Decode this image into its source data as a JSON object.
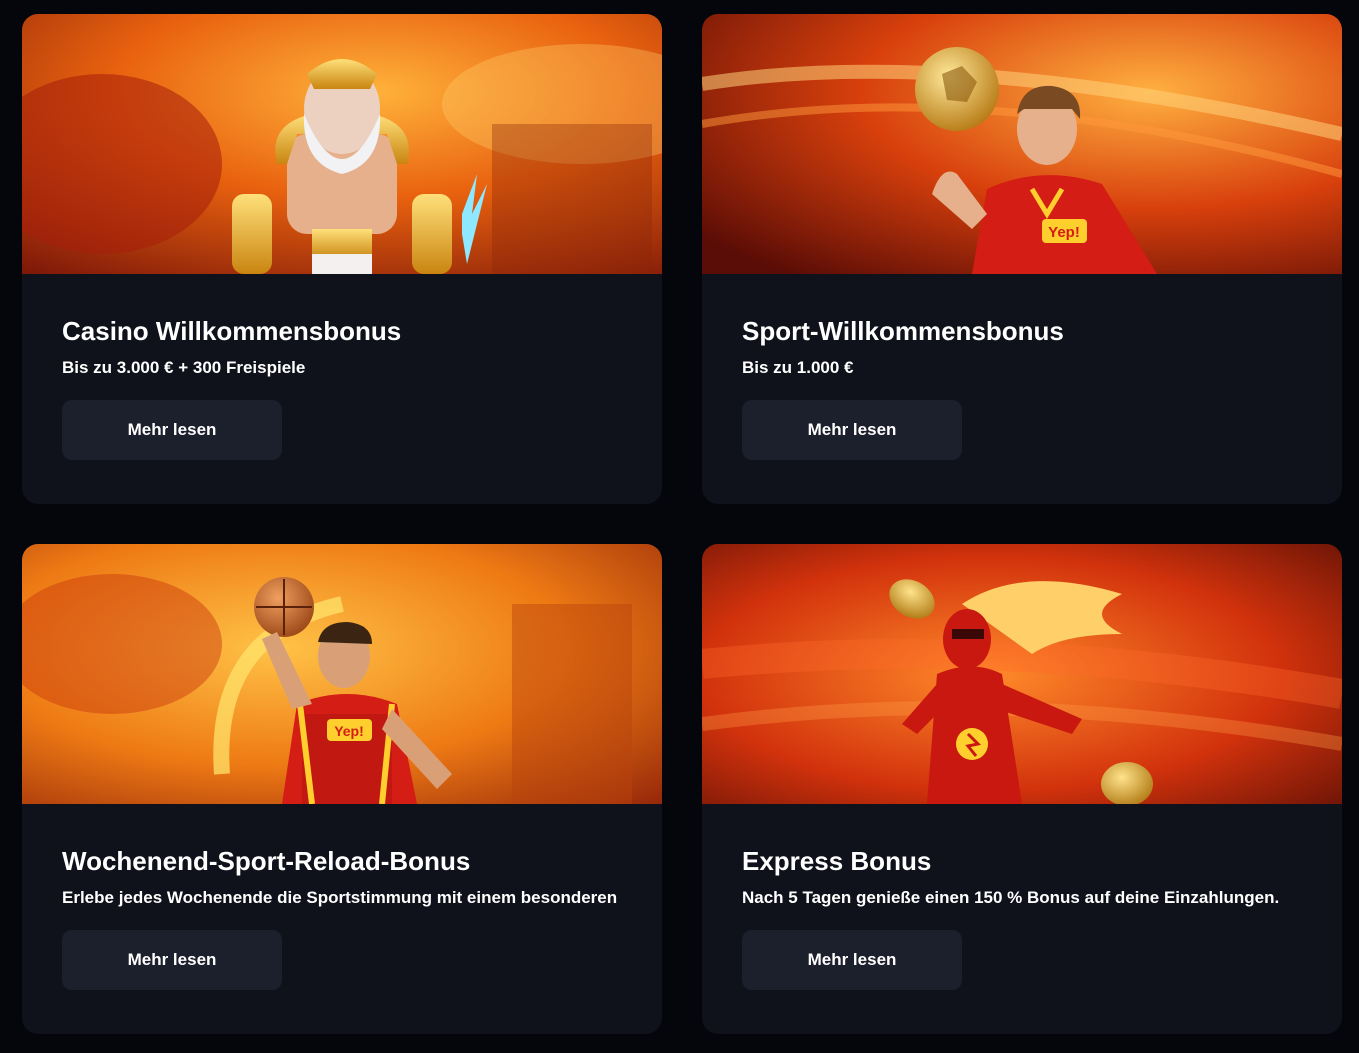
{
  "cards": [
    {
      "title": "Casino Willkommensbonus",
      "subtitle": "Bis zu 3.000 € + 300 Freispiele",
      "button_label": "Mehr lesen",
      "image": "zeus-character-illustration"
    },
    {
      "title": "Sport-Willkommensbonus",
      "subtitle": "Bis zu 1.000 €",
      "button_label": "Mehr lesen",
      "image": "football-player-illustration",
      "jersey_text": "Yep!"
    },
    {
      "title": "Wochenend-Sport-Reload-Bonus",
      "subtitle": "Erlebe jedes Wochenende die Sportstimmung mit einem besonderen",
      "button_label": "Mehr lesen",
      "image": "basketball-player-illustration",
      "jersey_text": "Yep!"
    },
    {
      "title": "Express Bonus",
      "subtitle": "Nach 5 Tagen genieße einen 150 % Bonus auf deine Einzahlungen.",
      "button_label": "Mehr lesen",
      "image": "speedster-heroine-illustration"
    }
  ],
  "colors": {
    "page_background": "#05060b",
    "card_background": "#0f111b",
    "button_background": "#1c1f2c",
    "accent_orange": "#f26a12",
    "accent_red": "#c8160f",
    "accent_gold": "#f2b527"
  }
}
